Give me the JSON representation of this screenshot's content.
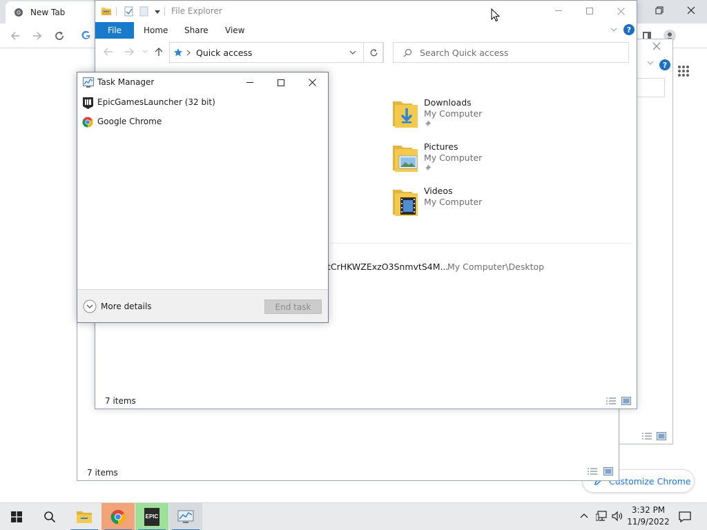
{
  "chrome": {
    "tab_title": "New Tab",
    "customize_label": "Customize Chrome"
  },
  "background_explorer": {
    "status": "7 items"
  },
  "file_explorer": {
    "title": "File Explorer",
    "ribbon": {
      "file": "File",
      "home": "Home",
      "share": "Share",
      "view": "View"
    },
    "address": "Quick access",
    "search_placeholder": "Search Quick access",
    "folders": [
      {
        "name": "Downloads",
        "location": "My Computer",
        "icon": "downloads-folder-icon",
        "pinned": true
      },
      {
        "name": "Pictures",
        "location": "My Computer",
        "icon": "pictures-folder-icon",
        "pinned": true
      },
      {
        "name": "Videos",
        "location": "My Computer",
        "icon": "videos-folder-icon",
        "pinned": false
      }
    ],
    "recent_file": {
      "name": "tCrHKWZExzO3SnmvtS4M...",
      "path": "My Computer\\Desktop"
    },
    "status": "7 items"
  },
  "task_manager": {
    "title": "Task Manager",
    "processes": [
      {
        "name": "EpicGamesLauncher (32 bit)",
        "icon": "epic-games-icon"
      },
      {
        "name": "Google Chrome",
        "icon": "chrome-icon"
      }
    ],
    "more_details": "More details",
    "end_task": "End task"
  },
  "taskbar": {
    "time": "3:32 PM",
    "date": "11/9/2022",
    "epic_icon_text": "EPIC"
  },
  "colors": {
    "ribbon_file_blue": "#1979ca",
    "folder_yellow": "#f3c94e",
    "chrome_link_blue": "#1a73e8",
    "taskbar_bg": "#e9eaec"
  }
}
